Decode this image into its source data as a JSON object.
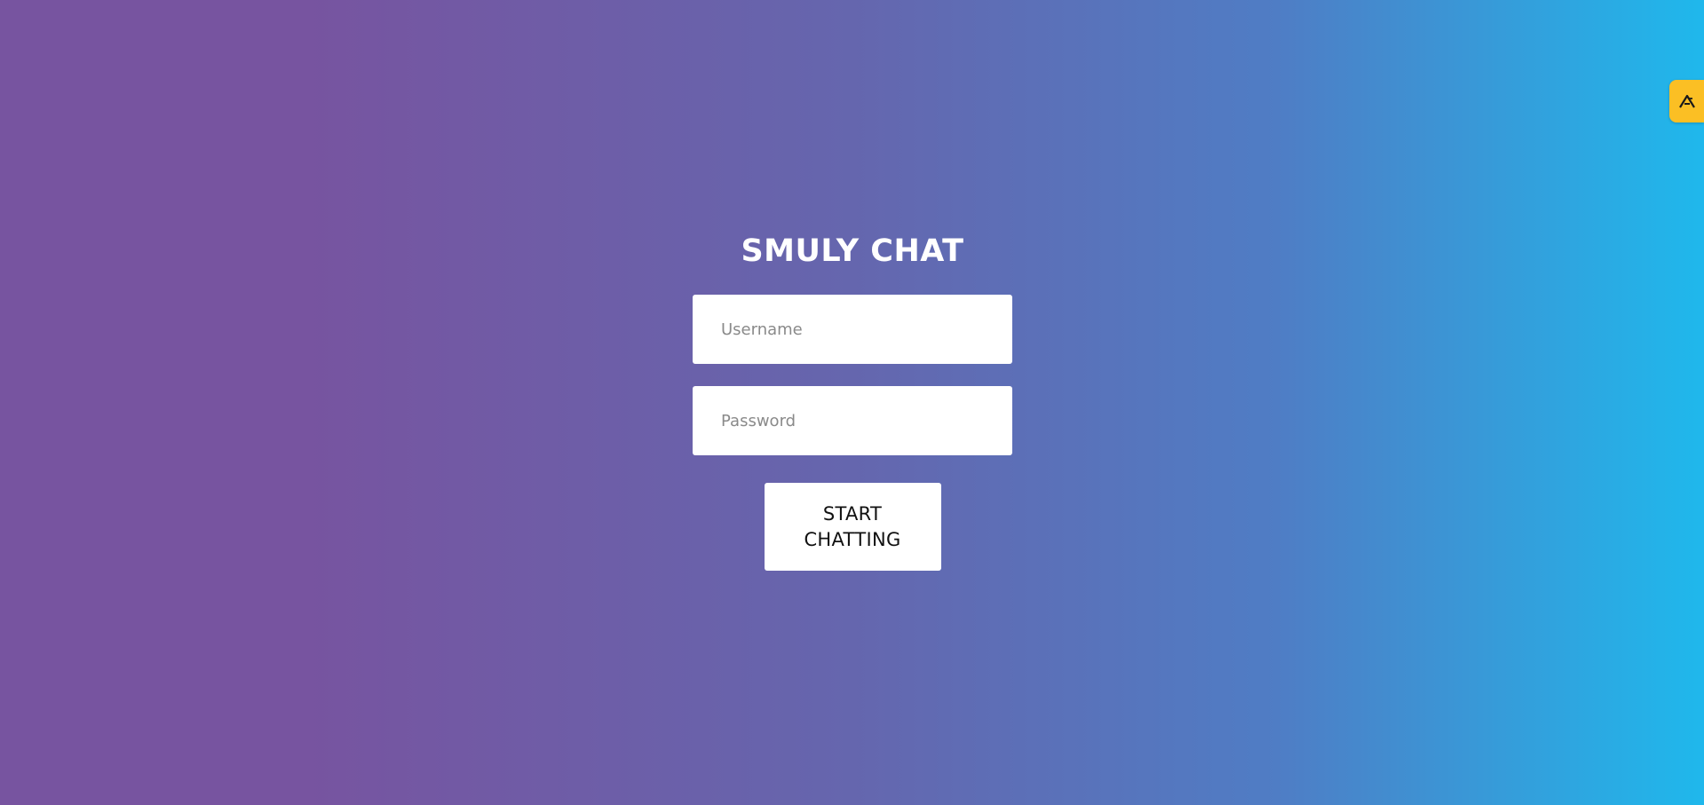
{
  "app": {
    "title": "SMULY CHAT"
  },
  "form": {
    "username_placeholder": "Username",
    "username_value": "",
    "password_placeholder": "Password",
    "password_value": "",
    "submit_label": "START CHATTING"
  },
  "extension": {
    "icon": "extension-logo-icon",
    "color": "#fbbf24"
  },
  "theme": {
    "gradient_start": "#7754a0",
    "gradient_mid": "#6566ae",
    "gradient_end": "#1fb8ec"
  }
}
